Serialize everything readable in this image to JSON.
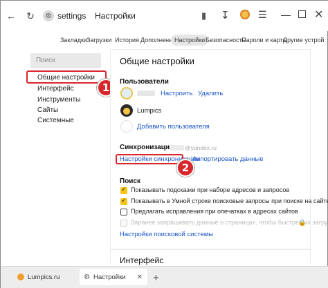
{
  "toolbar": {
    "back_icon": "arrow-left-icon",
    "reload_icon": "reload-icon",
    "address_host": "settings",
    "address_title": "Настройки",
    "window_buttons": [
      "minimize-icon",
      "maximize-icon",
      "close-icon"
    ]
  },
  "nav_tabs": [
    {
      "label": "Закладки",
      "active": false
    },
    {
      "label": "Загрузки",
      "active": false
    },
    {
      "label": "История",
      "active": false
    },
    {
      "label": "Дополнения",
      "active": false
    },
    {
      "label": "Настройки",
      "active": true
    },
    {
      "label": "Безопасность",
      "active": false
    },
    {
      "label": "Пароли и карты",
      "active": false
    },
    {
      "label": "Другие устрой",
      "active": false
    }
  ],
  "sidebar": {
    "search_placeholder": "Поиск",
    "items": [
      {
        "label": "Общие настройки"
      },
      {
        "label": "Интерфейс"
      },
      {
        "label": "Инструменты"
      },
      {
        "label": "Сайты"
      },
      {
        "label": "Системные"
      }
    ]
  },
  "main": {
    "title": "Общие настройки",
    "users": {
      "title": "Пользователи",
      "user1": {
        "configure": "Настроить",
        "delete": "Удалить"
      },
      "user2": {
        "name": "Lumpics"
      },
      "add_user": "Добавить пользователя"
    },
    "sync": {
      "title": "Синхронизация",
      "account_suffix": "@yandex.ru",
      "settings_link": "Настройки синхронизации",
      "import_link": "Импортировать данные"
    },
    "search": {
      "title": "Поиск",
      "options": [
        {
          "label": "Показывать подсказки при наборе адресов и запросов",
          "state": "checked"
        },
        {
          "label": "Показывать в Умной строке поисковые запросы при поиске на сайте",
          "state": "checked"
        },
        {
          "label": "Предлагать исправления при опечатках в адресах сайтов",
          "state": "empty"
        },
        {
          "label": "Заранее запрашивать данные о страницах, чтобы быстрее их загружать",
          "state": "disabled"
        }
      ],
      "engine_link": "Настройки поисковой системы"
    },
    "next_section": "Интерфейс"
  },
  "callouts": [
    "1",
    "2"
  ],
  "tabs": [
    {
      "label": "Lumpics.ru",
      "active": false
    },
    {
      "label": "Настройки",
      "active": true
    }
  ],
  "colors": {
    "accent_link": "#1a56c8",
    "callout_red": "#d8262d",
    "checkbox_yellow": "#f5c518"
  }
}
